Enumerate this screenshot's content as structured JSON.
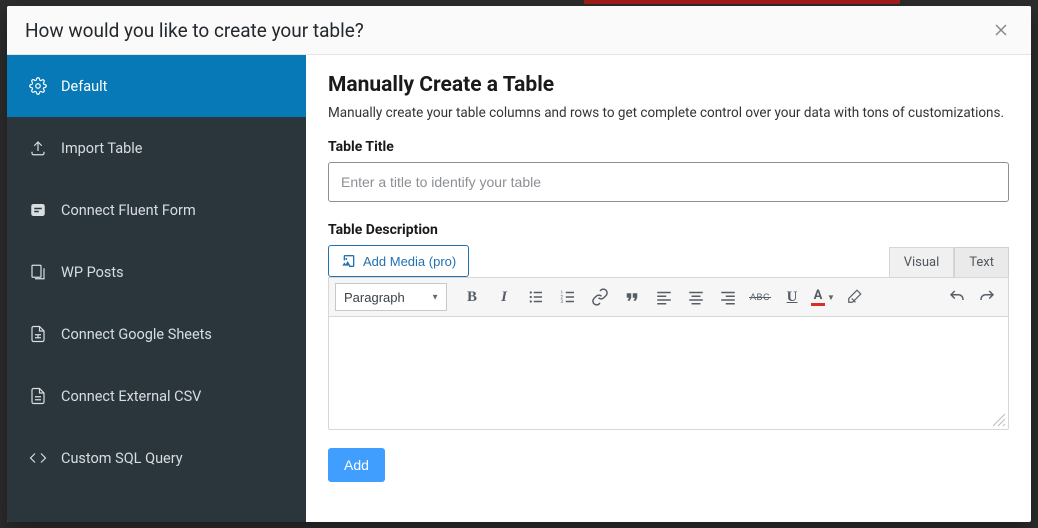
{
  "modal": {
    "title": "How would you like to create your table?"
  },
  "sidebar": {
    "items": [
      {
        "label": "Default"
      },
      {
        "label": "Import Table"
      },
      {
        "label": "Connect Fluent Form"
      },
      {
        "label": "WP Posts"
      },
      {
        "label": "Connect Google Sheets"
      },
      {
        "label": "Connect External CSV"
      },
      {
        "label": "Custom SQL Query"
      }
    ]
  },
  "main": {
    "title": "Manually Create a Table",
    "description": "Manually create your table columns and rows to get complete control over your data with tons of customizations.",
    "title_field_label": "Table Title",
    "title_placeholder": "Enter a title to identify your table",
    "desc_field_label": "Table Description",
    "add_media_label": "Add Media (pro)",
    "editor_tabs": {
      "visual": "Visual",
      "text": "Text"
    },
    "paragraph_select": "Paragraph",
    "add_button": "Add"
  }
}
